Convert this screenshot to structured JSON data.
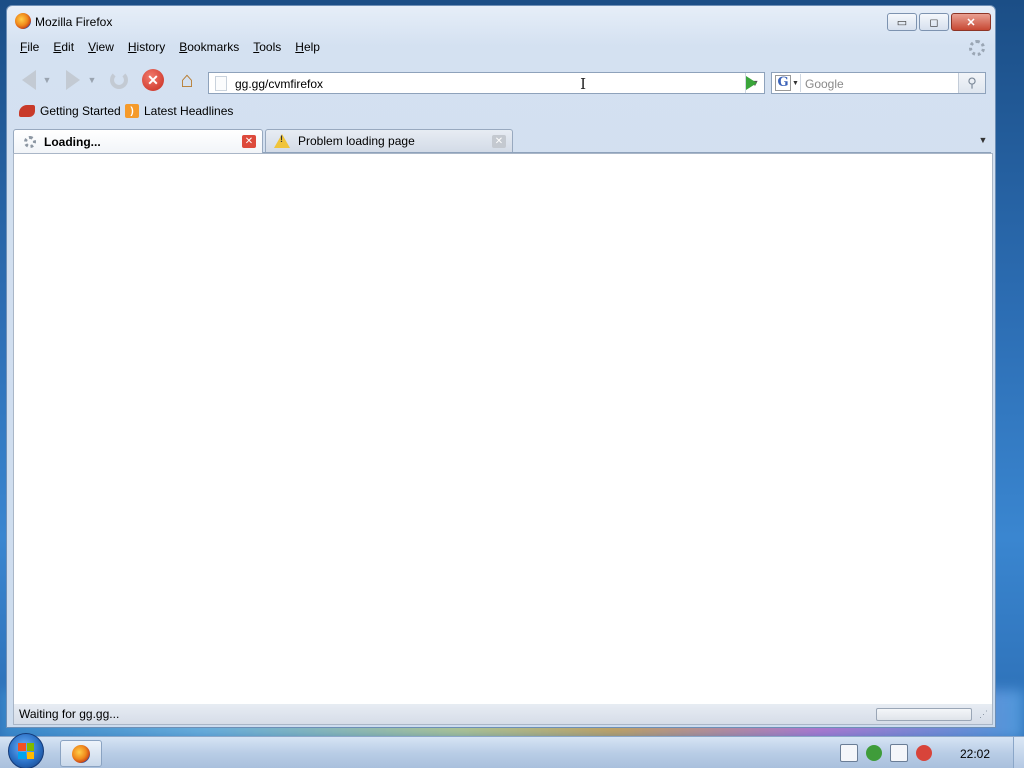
{
  "window": {
    "title": "Mozilla Firefox"
  },
  "window_controls": {
    "minimize": "▭",
    "maximize": "◻",
    "close": "✕"
  },
  "menubar": {
    "items": [
      {
        "label": "File",
        "underline": "F",
        "rest": "ile"
      },
      {
        "label": "Edit",
        "underline": "E",
        "rest": "dit"
      },
      {
        "label": "View",
        "underline": "V",
        "rest": "iew"
      },
      {
        "label": "History",
        "underline": "H",
        "rest": "istory"
      },
      {
        "label": "Bookmarks",
        "underline": "B",
        "rest": "ookmarks"
      },
      {
        "label": "Tools",
        "underline": "T",
        "rest": "ools"
      },
      {
        "label": "Help",
        "underline": "H",
        "rest": "elp"
      }
    ]
  },
  "navbar": {
    "url": "gg.gg/cvmfirefox",
    "search_placeholder": "Google",
    "search_engine": "G"
  },
  "bookmarks": {
    "items": [
      {
        "label": "Getting Started",
        "icon": "getting-started-icon"
      },
      {
        "label": "Latest Headlines",
        "icon": "rss-icon"
      }
    ]
  },
  "tabs": [
    {
      "label": "Loading...",
      "state": "active",
      "icon": "loading-spinner-icon"
    },
    {
      "label": "Problem loading page",
      "state": "inactive",
      "icon": "warning-icon"
    }
  ],
  "status": {
    "text": "Waiting for gg.gg..."
  },
  "taskbar": {
    "clock": "22:02"
  }
}
